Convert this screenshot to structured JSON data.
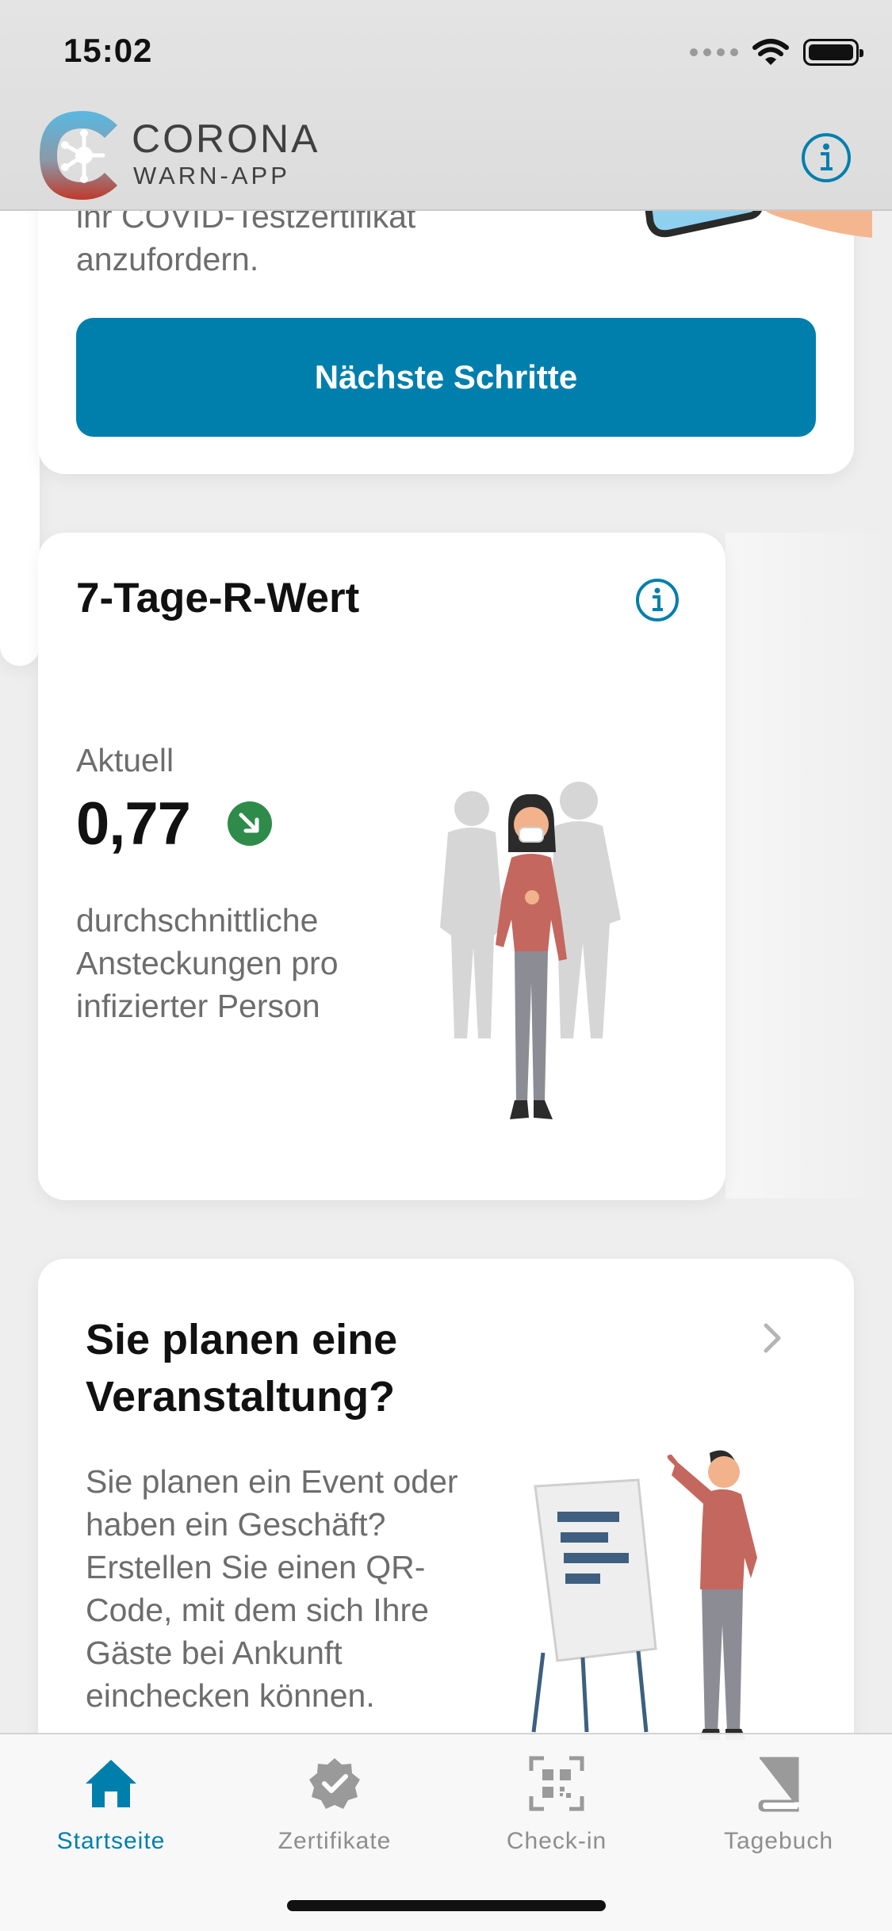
{
  "status_bar": {
    "time": "15:02"
  },
  "header": {
    "brand_line1": "CORONA",
    "brand_line2": "WARN-APP"
  },
  "test_card": {
    "text_partial": "ihr COVID-Testzertifikat anzufordern.",
    "button_label": "Nächste Schritte"
  },
  "r_value_card": {
    "title": "7-Tage-R-Wert",
    "current_label": "Aktuell",
    "value": "0,77",
    "description": "durchschnittliche Ansteckungen pro infizierter Person"
  },
  "event_card": {
    "title": "Sie planen eine Veranstaltung?",
    "description": "Sie planen ein Event oder haben ein Geschäft? Erstellen Sie einen QR-Code, mit dem sich Ihre Gäste bei Ankunft einchecken können."
  },
  "tabs": [
    {
      "label": "Startseite",
      "icon": "home-icon",
      "active": true
    },
    {
      "label": "Zertifikate",
      "icon": "certificate-icon",
      "active": false
    },
    {
      "label": "Check-in",
      "icon": "qr-scan-icon",
      "active": false
    },
    {
      "label": "Tagebuch",
      "icon": "diary-book-icon",
      "active": false
    }
  ],
  "colors": {
    "accent": "#007fad",
    "trend_down": "#2e8b4a"
  }
}
